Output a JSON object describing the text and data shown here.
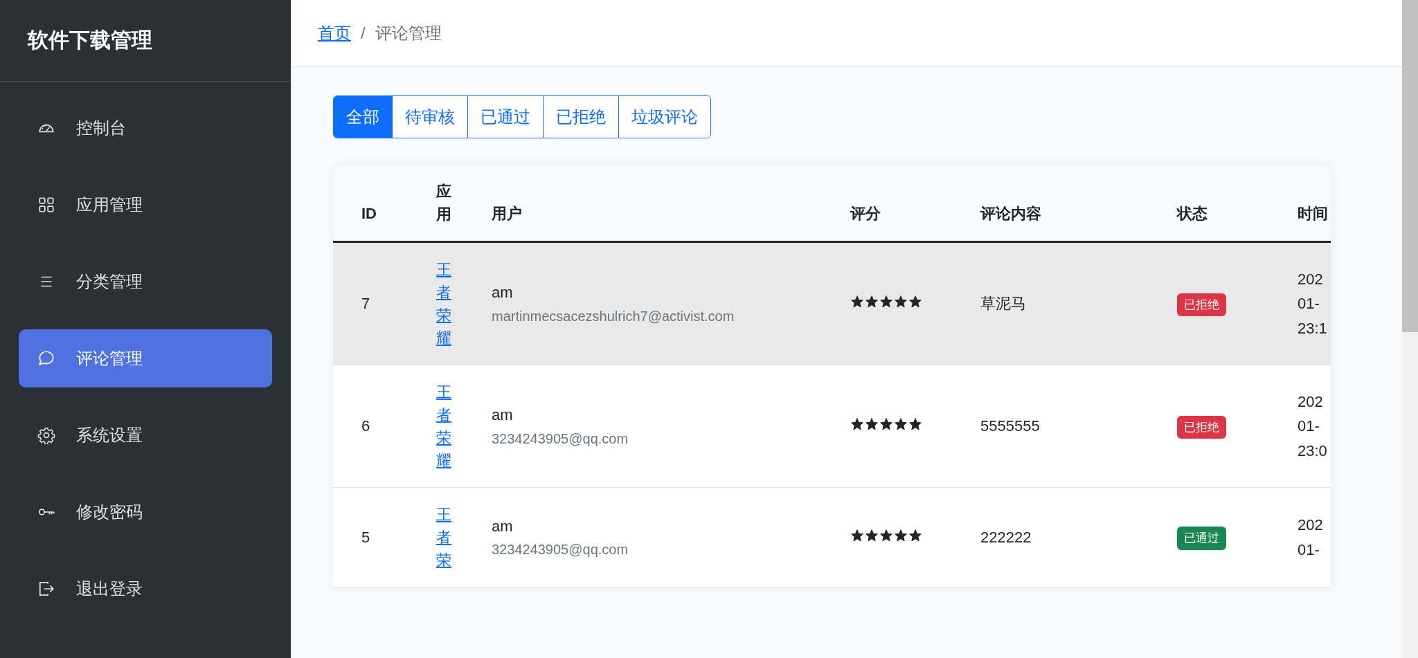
{
  "sidebar": {
    "title": "软件下载管理",
    "items": [
      {
        "label": "控制台",
        "selected": false
      },
      {
        "label": "应用管理",
        "selected": false
      },
      {
        "label": "分类管理",
        "selected": false
      },
      {
        "label": "评论管理",
        "selected": true
      },
      {
        "label": "系统设置",
        "selected": false
      },
      {
        "label": "修改密码",
        "selected": false
      },
      {
        "label": "退出登录",
        "selected": false
      }
    ]
  },
  "breadcrumb": {
    "home": "首页",
    "separator": "/",
    "current": "评论管理"
  },
  "tabs": [
    {
      "label": "全部",
      "selected": true
    },
    {
      "label": "待审核",
      "selected": false
    },
    {
      "label": "已通过",
      "selected": false
    },
    {
      "label": "已拒绝",
      "selected": false
    },
    {
      "label": "垃圾评论",
      "selected": false
    }
  ],
  "table": {
    "columns": [
      "ID",
      "应用",
      "用户",
      "评分",
      "评论内容",
      "状态",
      "时间"
    ],
    "rows": [
      {
        "selected": true,
        "id": "7",
        "app": "王者荣耀",
        "user": "am",
        "email": "martinmecsacezshulrich7@activist.com",
        "stars": 5,
        "content": "草泥马",
        "status": {
          "label": "已拒绝",
          "color": "#dc3545"
        },
        "time": [
          "202",
          "01-",
          "23:1"
        ]
      },
      {
        "selected": false,
        "id": "6",
        "app": "王者荣耀",
        "user": "am",
        "email": "3234243905@qq.com",
        "stars": 5,
        "content": "5555555",
        "status": {
          "label": "已拒绝",
          "color": "#dc3545"
        },
        "time": [
          "202",
          "01-",
          "23:0"
        ]
      },
      {
        "selected": false,
        "id": "5",
        "app": "王者荣",
        "user": "am",
        "email": "3234243905@qq.com",
        "stars": 5,
        "content": "222222",
        "status": {
          "label": "已通过",
          "color": "#198754"
        },
        "time": [
          "202",
          "01-"
        ]
      }
    ]
  }
}
